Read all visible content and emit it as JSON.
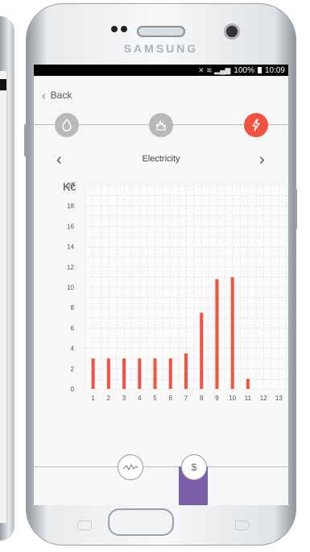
{
  "device": {
    "brand": "SAMSUNG"
  },
  "status_bar": {
    "battery": "100%",
    "time": "10:09"
  },
  "nav": {
    "back_label": "Back"
  },
  "utilities": [
    {
      "name": "water",
      "icon": "water-drop-icon",
      "active": false
    },
    {
      "name": "gas",
      "icon": "flame-icon",
      "active": false
    },
    {
      "name": "electricity",
      "icon": "lightning-icon",
      "active": true
    }
  ],
  "header": {
    "title": "Electricity"
  },
  "colors": {
    "accent": "#f0533f",
    "inactive": "#b9b9b9",
    "tab_indicator": "#7b5ea8"
  },
  "chart_data": {
    "type": "bar",
    "ylabel": "Kč",
    "ylim": [
      0,
      20
    ],
    "yticks": [
      0,
      2,
      4,
      6,
      8,
      10,
      12,
      14,
      16,
      18,
      20
    ],
    "categories": [
      "1",
      "2",
      "3",
      "4",
      "5",
      "6",
      "7",
      "8",
      "9",
      "10",
      "11",
      "12",
      "13"
    ],
    "values": [
      3,
      3,
      3,
      3,
      3,
      3,
      3.5,
      7.5,
      10.8,
      11,
      1,
      0,
      0
    ],
    "grid": true,
    "bar_color": "#f0533f"
  },
  "bottom_tabs": [
    {
      "name": "consumption",
      "icon": "wave-chart-icon",
      "active": false
    },
    {
      "name": "cost",
      "icon": "dollar-icon",
      "active": true
    }
  ]
}
